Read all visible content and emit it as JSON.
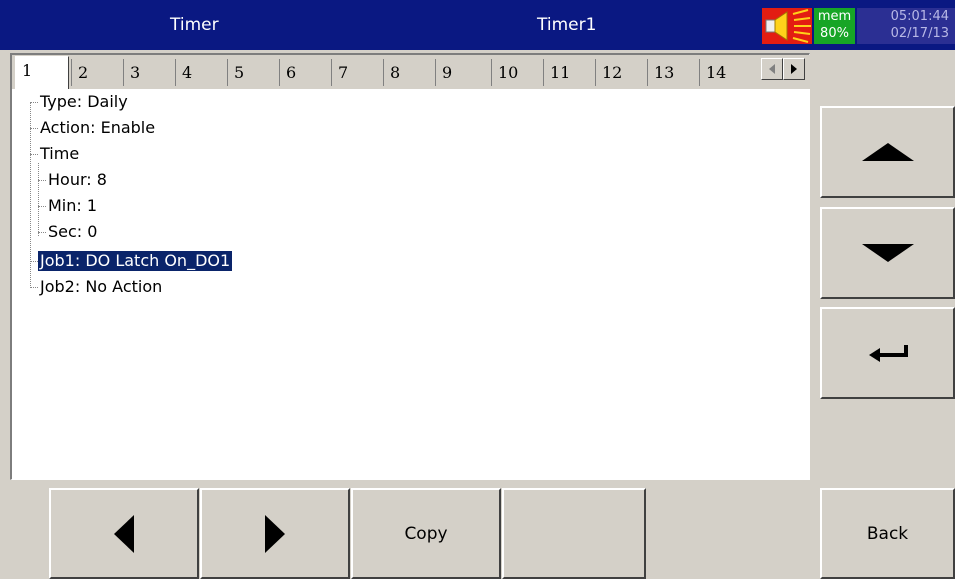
{
  "header": {
    "left_title": "Timer",
    "center_title": "Timer1",
    "mem_label": "mem",
    "mem_value": "80%",
    "time": "05:01:44",
    "date": "02/17/13"
  },
  "tabs": [
    "1",
    "2",
    "3",
    "4",
    "5",
    "6",
    "7",
    "8",
    "9",
    "10",
    "11",
    "12",
    "13",
    "14"
  ],
  "active_tab": "1",
  "tree": {
    "type": "Type: Daily",
    "action": "Action: Enable",
    "time": "Time",
    "hour": "Hour: 8",
    "min": "Min: 1",
    "sec": "Sec: 0",
    "job1": "Job1: DO Latch On_DO1",
    "job2": "Job2: No Action"
  },
  "selected_item": "Job1: DO Latch On_DO1",
  "buttons": {
    "copy": "Copy",
    "back": "Back"
  },
  "icons": [
    "speaker-icon",
    "up-arrow-icon",
    "down-arrow-icon",
    "enter-icon",
    "left-arrow-icon",
    "right-arrow-icon",
    "scroll-left-icon",
    "scroll-right-icon"
  ],
  "colors": {
    "titlebar": "#0a1882",
    "speaker_bg": "#e31d12",
    "mem_bg": "#17a526",
    "clock_bg": "#2b2f93",
    "selection": "#0a246a"
  }
}
